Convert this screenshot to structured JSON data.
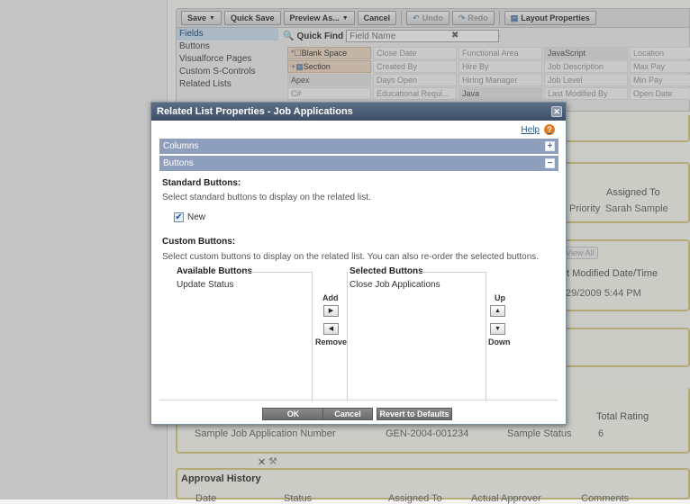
{
  "toolbar": {
    "save": "Save",
    "quick_save": "Quick Save",
    "preview_as": "Preview As...",
    "cancel": "Cancel",
    "undo": "Undo",
    "redo": "Redo",
    "layout_properties": "Layout Properties"
  },
  "palette": {
    "categories": [
      "Fields",
      "Buttons",
      "Visualforce Pages",
      "Custom S-Controls",
      "Related Lists"
    ],
    "quick_find_label": "Quick Find",
    "quick_find_placeholder": "Field Name",
    "items": [
      "Blank Space",
      "Close Date",
      "Functional Area",
      "JavaScript",
      "Location",
      "Section",
      "Created By",
      "Hire By",
      "Job Description",
      "Max Pay",
      "Apex",
      "Days Open",
      "Hiring Manager",
      "Job Level",
      "Min Pay",
      "C#",
      "Educational Requi...",
      "Java",
      "Last Modified By",
      "Open Date"
    ]
  },
  "background": {
    "assigned_to_header": "Assigned To",
    "priority_cell": "Priority",
    "assigned_value": "Sarah Sample",
    "view_all": "View All",
    "last_modified_header": "t Modified Date/Time",
    "last_modified_value": "29/2009 5:44 PM",
    "total_rating_header": "Total Rating",
    "job_app_row": {
      "name": "Sample Job Application Number",
      "number": "GEN-2004-001234",
      "status": "Sample Status",
      "rating": "6"
    },
    "approval_history_title": "Approval History",
    "approval_columns": [
      "Date",
      "Status",
      "Assigned To",
      "Actual Approver",
      "Comments"
    ]
  },
  "modal": {
    "title": "Related List Properties - Job Applications",
    "help": "Help",
    "columns_section": "Columns",
    "buttons_section": "Buttons",
    "standard_heading": "Standard Buttons:",
    "standard_desc": "Select standard buttons to display on the related list.",
    "new_label": "New",
    "custom_heading": "Custom Buttons:",
    "custom_desc": "Select custom buttons to display on the related list. You can also re-order the selected buttons.",
    "available_title": "Available Buttons",
    "available_items": [
      "Update Status"
    ],
    "selected_title": "Selected Buttons",
    "selected_items": [
      "Close Job Applications"
    ],
    "add": "Add",
    "remove": "Remove",
    "up": "Up",
    "down": "Down",
    "ok": "OK",
    "cancel": "Cancel",
    "revert": "Revert to Defaults"
  }
}
